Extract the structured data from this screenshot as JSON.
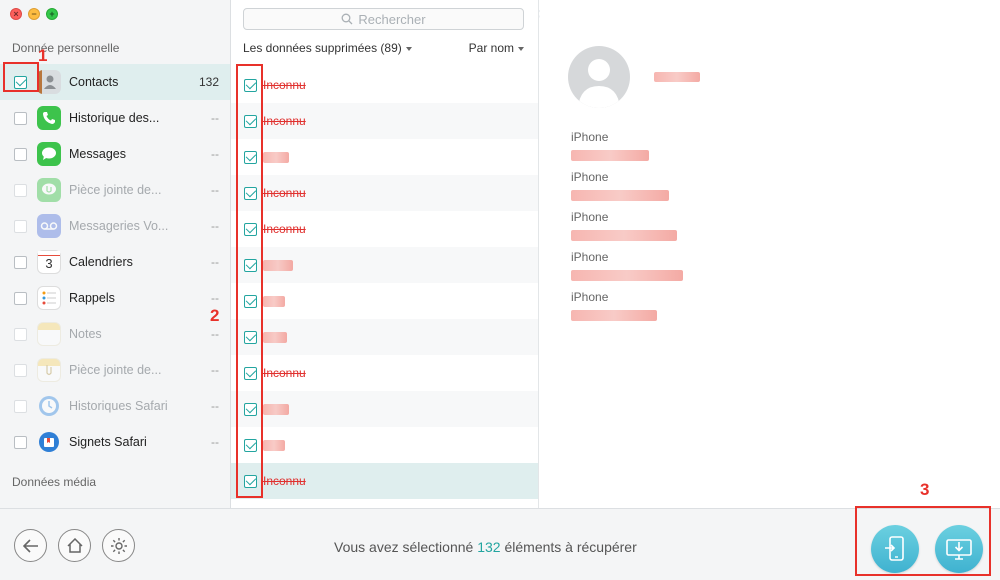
{
  "window": {
    "close_glyph": "×",
    "minimize_glyph": "−",
    "zoom_glyph": "+"
  },
  "sidebar": {
    "section_personal": "Donnée personnelle",
    "section_media": "Données média",
    "items": [
      {
        "label": "Contacts",
        "count": "132",
        "icon": "contacts-icon",
        "checked": true,
        "disabled": false,
        "selected": true
      },
      {
        "label": "Historique des...",
        "count": "--",
        "icon": "phone-icon",
        "checked": false,
        "disabled": false,
        "selected": false
      },
      {
        "label": "Messages",
        "count": "--",
        "icon": "messages-icon",
        "checked": false,
        "disabled": false,
        "selected": false
      },
      {
        "label": "Pièce jointe de...",
        "count": "--",
        "icon": "message-attachment-icon",
        "checked": false,
        "disabled": true,
        "selected": false
      },
      {
        "label": "Messageries Vo...",
        "count": "--",
        "icon": "voicemail-icon",
        "checked": false,
        "disabled": true,
        "selected": false
      },
      {
        "label": "Calendriers",
        "count": "--",
        "icon": "calendar-icon",
        "checked": false,
        "disabled": false,
        "selected": false
      },
      {
        "label": "Rappels",
        "count": "--",
        "icon": "reminders-icon",
        "checked": false,
        "disabled": false,
        "selected": false
      },
      {
        "label": "Notes",
        "count": "--",
        "icon": "notes-icon",
        "checked": false,
        "disabled": true,
        "selected": false
      },
      {
        "label": "Pièce jointe de...",
        "count": "--",
        "icon": "notes-attachment-icon",
        "checked": false,
        "disabled": true,
        "selected": false
      },
      {
        "label": "Historiques Safari",
        "count": "--",
        "icon": "safari-history-icon",
        "checked": false,
        "disabled": true,
        "selected": false
      },
      {
        "label": "Signets Safari",
        "count": "--",
        "icon": "safari-bookmarks-icon",
        "checked": false,
        "disabled": false,
        "selected": false
      }
    ],
    "calendar_day": "3"
  },
  "list": {
    "search_placeholder": "Rechercher",
    "filter_label": "Les données supprimées (89)",
    "sort_label": "Par nom",
    "rows": [
      {
        "label": "Inconnu",
        "blurred": false
      },
      {
        "label": "Inconnu",
        "blurred": false
      },
      {
        "label": "",
        "blurred": true
      },
      {
        "label": "Inconnu",
        "blurred": false
      },
      {
        "label": "Inconnu",
        "blurred": false
      },
      {
        "label": "",
        "blurred": true
      },
      {
        "label": "",
        "blurred": true
      },
      {
        "label": "",
        "blurred": true
      },
      {
        "label": "Inconnu",
        "blurred": false
      },
      {
        "label": "",
        "blurred": true
      },
      {
        "label": "",
        "blurred": true
      },
      {
        "label": "Inconnu",
        "blurred": false
      }
    ]
  },
  "detail": {
    "phones": [
      "iPhone",
      "iPhone",
      "iPhone",
      "iPhone",
      "iPhone"
    ]
  },
  "bottom": {
    "status_prefix": "Vous avez sélectionné",
    "status_count": "132",
    "status_suffix": "éléments à récupérer"
  },
  "annotations": {
    "one": "1",
    "two": "2",
    "three": "3"
  },
  "colors": {
    "accent": "#23a5a0",
    "annotation": "#e8312a",
    "deleted_text": "#e0312f"
  }
}
